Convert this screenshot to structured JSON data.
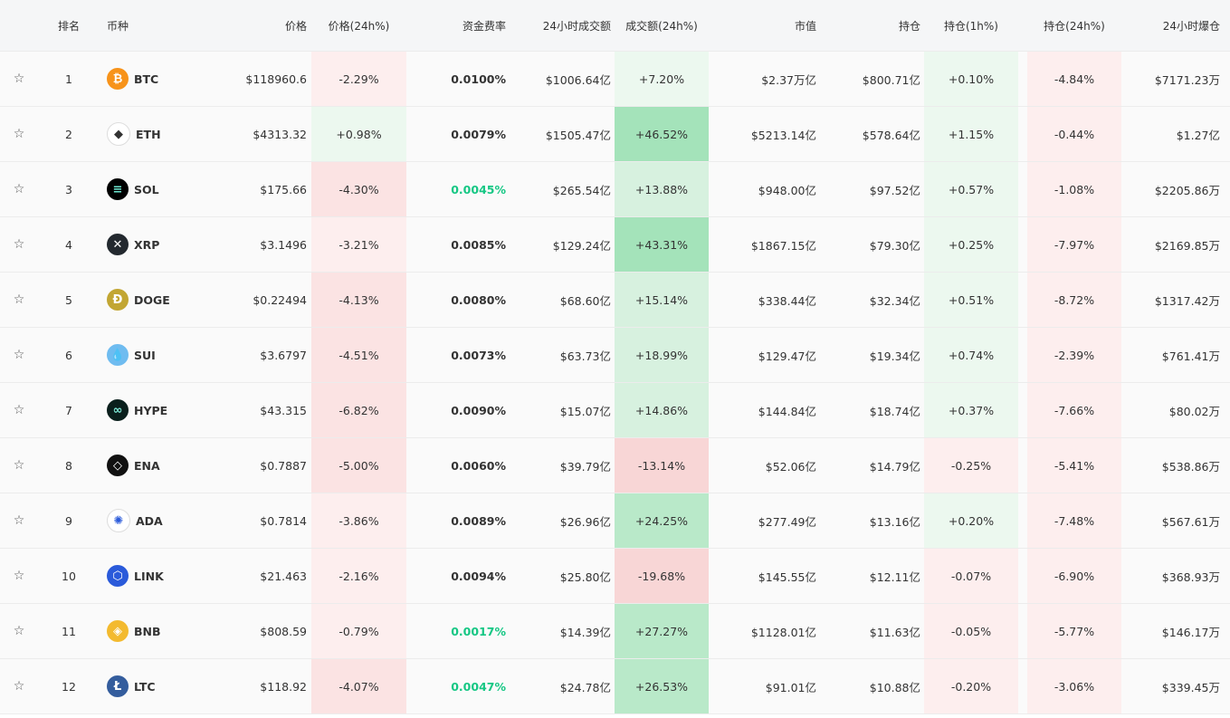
{
  "headers": {
    "rank": "排名",
    "coin": "币种",
    "price": "价格",
    "price_change": "价格(24h%)",
    "funding": "资金费率",
    "volume": "24小时成交额",
    "volume_change": "成交额(24h%)",
    "market_cap": "市值",
    "open_interest": "持仓",
    "oi_1h": "持仓(1h%)",
    "oi_24h": "持仓(24h%)",
    "liquidation": "24小时爆仓"
  },
  "colors": {
    "btc": "#f7931a",
    "eth": "#ffffff",
    "sol": "#000000",
    "xrp": "#23292f",
    "doge": "#c2a633",
    "sui": "#6fbcf0",
    "hype": "#0a1f1c",
    "ena": "#111111",
    "ada": "#ffffff",
    "link": "#2a5ada",
    "bnb": "#f3ba2f",
    "ltc": "#345d9d",
    "funding_green": "#16c784"
  },
  "rows": [
    {
      "star": "☆",
      "rank": "1",
      "symbol": "BTC",
      "icon": "bitcoin-icon",
      "glyph": "₿",
      "price": "$118960.6",
      "price_change": "-2.29%",
      "funding": "0.0100%",
      "volume": "$1006.64亿",
      "volume_change": "+7.20%",
      "market_cap": "$2.37万亿",
      "open_interest": "$800.71亿",
      "oi_1h": "+0.10%",
      "oi_24h": "-4.84%",
      "liquidation": "$7171.23万"
    },
    {
      "star": "☆",
      "rank": "2",
      "symbol": "ETH",
      "icon": "ethereum-icon",
      "glyph": "◆",
      "price": "$4313.32",
      "price_change": "+0.98%",
      "funding": "0.0079%",
      "volume": "$1505.47亿",
      "volume_change": "+46.52%",
      "market_cap": "$5213.14亿",
      "open_interest": "$578.64亿",
      "oi_1h": "+1.15%",
      "oi_24h": "-0.44%",
      "liquidation": "$1.27亿"
    },
    {
      "star": "☆",
      "rank": "3",
      "symbol": "SOL",
      "icon": "solana-icon",
      "glyph": "≡",
      "price": "$175.66",
      "price_change": "-4.30%",
      "funding": "0.0045%",
      "volume": "$265.54亿",
      "volume_change": "+13.88%",
      "market_cap": "$948.00亿",
      "open_interest": "$97.52亿",
      "oi_1h": "+0.57%",
      "oi_24h": "-1.08%",
      "liquidation": "$2205.86万"
    },
    {
      "star": "☆",
      "rank": "4",
      "symbol": "XRP",
      "icon": "xrp-icon",
      "glyph": "✕",
      "price": "$3.1496",
      "price_change": "-3.21%",
      "funding": "0.0085%",
      "volume": "$129.24亿",
      "volume_change": "+43.31%",
      "market_cap": "$1867.15亿",
      "open_interest": "$79.30亿",
      "oi_1h": "+0.25%",
      "oi_24h": "-7.97%",
      "liquidation": "$2169.85万"
    },
    {
      "star": "☆",
      "rank": "5",
      "symbol": "DOGE",
      "icon": "dogecoin-icon",
      "glyph": "Ð",
      "price": "$0.22494",
      "price_change": "-4.13%",
      "funding": "0.0080%",
      "volume": "$68.60亿",
      "volume_change": "+15.14%",
      "market_cap": "$338.44亿",
      "open_interest": "$32.34亿",
      "oi_1h": "+0.51%",
      "oi_24h": "-8.72%",
      "liquidation": "$1317.42万"
    },
    {
      "star": "☆",
      "rank": "6",
      "symbol": "SUI",
      "icon": "sui-icon",
      "glyph": "💧",
      "price": "$3.6797",
      "price_change": "-4.51%",
      "funding": "0.0073%",
      "volume": "$63.73亿",
      "volume_change": "+18.99%",
      "market_cap": "$129.47亿",
      "open_interest": "$19.34亿",
      "oi_1h": "+0.74%",
      "oi_24h": "-2.39%",
      "liquidation": "$761.41万"
    },
    {
      "star": "☆",
      "rank": "7",
      "symbol": "HYPE",
      "icon": "hyperliquid-icon",
      "glyph": "∞",
      "price": "$43.315",
      "price_change": "-6.82%",
      "funding": "0.0090%",
      "volume": "$15.07亿",
      "volume_change": "+14.86%",
      "market_cap": "$144.84亿",
      "open_interest": "$18.74亿",
      "oi_1h": "+0.37%",
      "oi_24h": "-7.66%",
      "liquidation": "$80.02万"
    },
    {
      "star": "☆",
      "rank": "8",
      "symbol": "ENA",
      "icon": "ethena-icon",
      "glyph": "◇",
      "price": "$0.7887",
      "price_change": "-5.00%",
      "funding": "0.0060%",
      "volume": "$39.79亿",
      "volume_change": "-13.14%",
      "market_cap": "$52.06亿",
      "open_interest": "$14.79亿",
      "oi_1h": "-0.25%",
      "oi_24h": "-5.41%",
      "liquidation": "$538.86万"
    },
    {
      "star": "☆",
      "rank": "9",
      "symbol": "ADA",
      "icon": "cardano-icon",
      "glyph": "✺",
      "price": "$0.7814",
      "price_change": "-3.86%",
      "funding": "0.0089%",
      "volume": "$26.96亿",
      "volume_change": "+24.25%",
      "market_cap": "$277.49亿",
      "open_interest": "$13.16亿",
      "oi_1h": "+0.20%",
      "oi_24h": "-7.48%",
      "liquidation": "$567.61万"
    },
    {
      "star": "☆",
      "rank": "10",
      "symbol": "LINK",
      "icon": "chainlink-icon",
      "glyph": "⬡",
      "price": "$21.463",
      "price_change": "-2.16%",
      "funding": "0.0094%",
      "volume": "$25.80亿",
      "volume_change": "-19.68%",
      "market_cap": "$145.55亿",
      "open_interest": "$12.11亿",
      "oi_1h": "-0.07%",
      "oi_24h": "-6.90%",
      "liquidation": "$368.93万"
    },
    {
      "star": "☆",
      "rank": "11",
      "symbol": "BNB",
      "icon": "bnb-icon",
      "glyph": "◈",
      "price": "$808.59",
      "price_change": "-0.79%",
      "funding": "0.0017%",
      "volume": "$14.39亿",
      "volume_change": "+27.27%",
      "market_cap": "$1128.01亿",
      "open_interest": "$11.63亿",
      "oi_1h": "-0.05%",
      "oi_24h": "-5.77%",
      "liquidation": "$146.17万"
    },
    {
      "star": "☆",
      "rank": "12",
      "symbol": "LTC",
      "icon": "litecoin-icon",
      "glyph": "Ł",
      "price": "$118.92",
      "price_change": "-4.07%",
      "funding": "0.0047%",
      "volume": "$24.78亿",
      "volume_change": "+26.53%",
      "market_cap": "$91.01亿",
      "open_interest": "$10.88亿",
      "oi_1h": "-0.20%",
      "oi_24h": "-3.06%",
      "liquidation": "$339.45万"
    }
  ]
}
